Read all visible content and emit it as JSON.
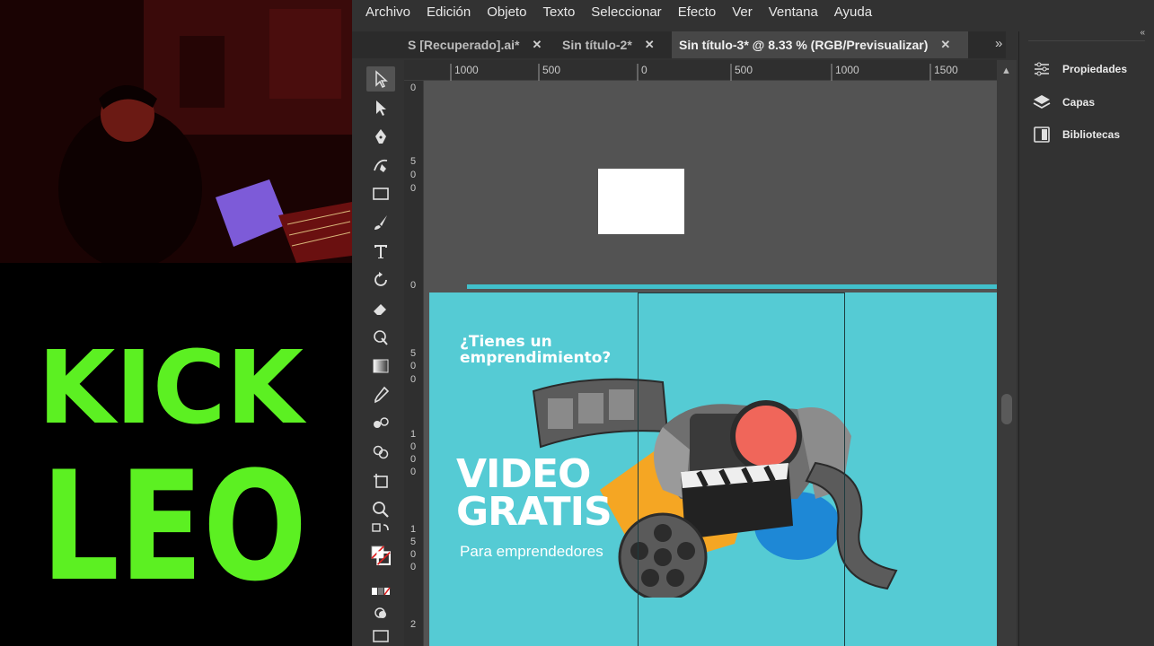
{
  "overlay": {
    "logo_line1": "KICK",
    "logo_line2": "LEO",
    "logo_color": "#5cf022"
  },
  "menubar": {
    "items": [
      "Archivo",
      "Edición",
      "Objeto",
      "Texto",
      "Seleccionar",
      "Efecto",
      "Ver",
      "Ventana",
      "Ayuda"
    ]
  },
  "tabs": [
    {
      "label": "S [Recuperado].ai*",
      "close": "✕",
      "active": false
    },
    {
      "label": "Sin título-2*",
      "close": "✕",
      "active": false
    },
    {
      "label": "Sin título-3* @ 8.33 % (RGB/Previsualizar)",
      "close": "✕",
      "active": true
    }
  ],
  "tab_controls": {
    "collapse": "»",
    "overflow": "»"
  },
  "rulers": {
    "horizontal": [
      "1000",
      "500",
      "0",
      "500",
      "1000",
      "1500"
    ],
    "vertical": [
      [
        "0"
      ],
      [
        "5",
        "0",
        "0"
      ],
      [
        "0"
      ],
      [
        "5",
        "0",
        "0"
      ],
      [
        "1",
        "0",
        "0",
        "0"
      ],
      [
        "1",
        "5",
        "0",
        "0"
      ],
      [
        "2"
      ]
    ]
  },
  "artboard": {
    "question": "¿Tienes un emprendimiento?",
    "question_line1": "¿Tienes un",
    "question_line2": "emprendimiento?",
    "title_line1": "VIDEO",
    "title_line2": "GRATIS",
    "subtitle": "Para emprendedores",
    "background": "#55cbd4"
  },
  "tools": [
    "selection-tool-icon",
    "direct-selection-tool-icon",
    "pen-tool-icon",
    "curvature-tool-icon",
    "rectangle-tool-icon",
    "paintbrush-tool-icon",
    "type-tool-icon",
    "rotate-tool-icon",
    "eraser-tool-icon",
    "warp-tool-icon",
    "gradient-tool-icon",
    "eyedropper-tool-icon",
    "blend-tool-icon",
    "shape-builder-tool-icon",
    "artboard-tool-icon",
    "zoom-tool-icon"
  ],
  "panels": {
    "items": [
      {
        "label": "Propiedades",
        "icon": "properties-icon"
      },
      {
        "label": "Capas",
        "icon": "layers-icon"
      },
      {
        "label": "Bibliotecas",
        "icon": "libraries-icon"
      }
    ],
    "collapse": "«"
  },
  "colors": {
    "app_bg": "#323232",
    "canvas_bg": "#535353",
    "artboard_teal": "#55cbd4",
    "accent_orange": "#f5a623",
    "accent_red": "#f0665a",
    "accent_blue": "#1e88d6"
  }
}
